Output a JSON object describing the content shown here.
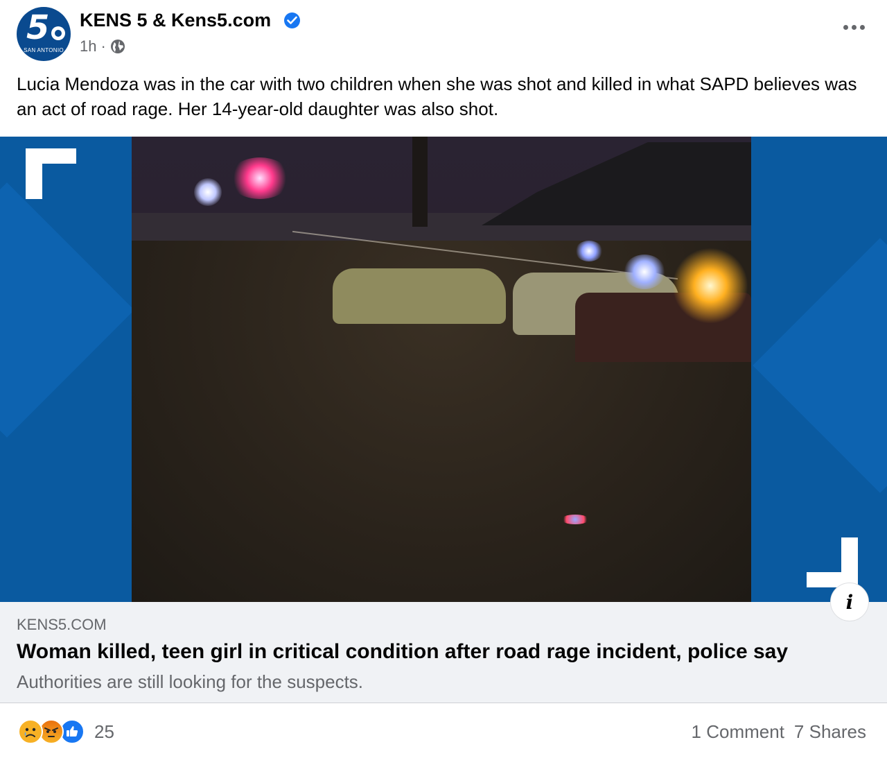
{
  "post": {
    "page_name": "KENS 5 & Kens5.com",
    "avatar_text": "5",
    "avatar_city": "SAN ANTONIO",
    "time": "1h",
    "separator": "·",
    "text": "Lucia Mendoza was in the car with two children when she was shot and killed in what SAPD believes was an act of road rage. Her 14-year-old daughter was also shot."
  },
  "link": {
    "domain": "KENS5.COM",
    "title": "Woman killed, teen girl in critical condition after road rage incident, police say",
    "description": "Authorities are still looking for the suspects."
  },
  "info_icon_glyph": "i",
  "footer": {
    "reaction_count": "25",
    "comments": "1 Comment",
    "shares": "7 Shares",
    "reactions": [
      "sad-reaction-icon",
      "angry-reaction-icon",
      "like-reaction-icon"
    ]
  },
  "colors": {
    "verified": "#1877f2",
    "brand_blue": "#0a5aa0",
    "secondary_text": "#65676b"
  }
}
